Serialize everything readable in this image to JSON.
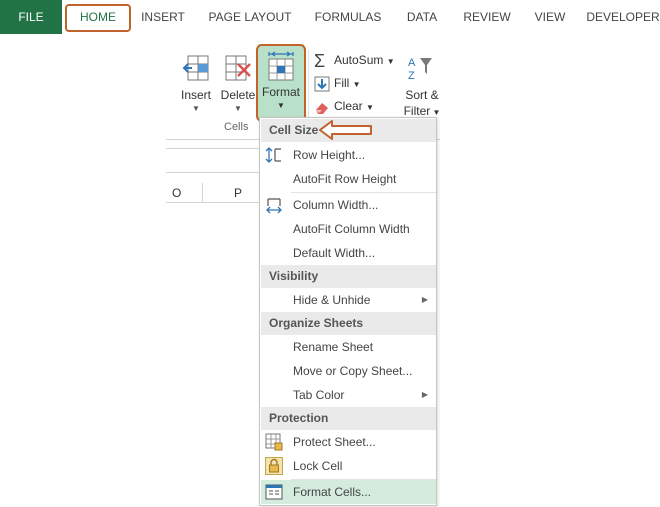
{
  "tabs": [
    "FILE",
    "HOME",
    "INSERT",
    "PAGE LAYOUT",
    "FORMULAS",
    "DATA",
    "REVIEW",
    "VIEW",
    "DEVELOPER"
  ],
  "ribbon": {
    "insert_label": "Insert",
    "delete_label": "Delete",
    "format_label": "Format",
    "group_cells": "Cells",
    "autosum_label": "AutoSum",
    "fill_label": "Fill",
    "clear_label": "Clear",
    "sort_label": "Sort &",
    "filter_label": "Filter"
  },
  "sheet": {
    "columns": [
      "O",
      "P"
    ]
  },
  "menu": {
    "cell_size": "Cell Size",
    "row_height": "Row Height...",
    "autofit_row": "AutoFit Row Height",
    "column_width": "Column Width...",
    "autofit_column": "AutoFit Column Width",
    "default_width": "Default Width...",
    "visibility": "Visibility",
    "hide_unhide": "Hide & Unhide",
    "organize_sheets": "Organize Sheets",
    "rename_sheet": "Rename Sheet",
    "move_copy": "Move or Copy Sheet...",
    "tab_color": "Tab Color",
    "protection": "Protection",
    "protect_sheet": "Protect Sheet...",
    "lock_cell": "Lock Cell",
    "format_cells": "Format Cells..."
  },
  "colors": {
    "excel_green": "#217346",
    "highlight": "#c0642c",
    "menu_hover": "#d3ecdd"
  }
}
